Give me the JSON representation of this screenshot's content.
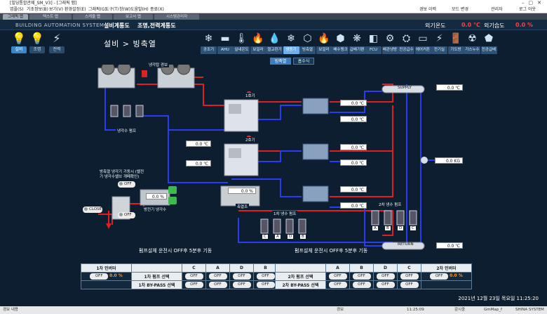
{
  "window": {
    "title": "[빌딩통합관제_SM_V3] - [그래픽 맵]"
  },
  "menu": {
    "items": [
      "엽플(S)",
      "기초정보(B)",
      "보기(V)",
      "환경설정(E)",
      "그래픽(G)",
      "도구(T)",
      "창(W)",
      "도움말(H)",
      "종료(X)"
    ],
    "right": [
      "경보 이력",
      "모드 변경",
      "관리자",
      "로그 아웃"
    ]
  },
  "tabs": [
    "그래픽 맵",
    "텍스트 맵",
    "스케쥴 맵",
    "보고서 맵",
    "시스템관리자"
  ],
  "header": {
    "system_name": "BUILDING AUTOMATION SYSTEM",
    "nav1": "설비계통도",
    "nav2": "조명,전력계통도",
    "out_temp_label": "외기온도",
    "out_temp_value": "0.0 ℃",
    "out_hum_label": "외기습도",
    "out_hum_value": "0.0 %"
  },
  "modes": [
    "설비",
    "조명",
    "전력"
  ],
  "page_title": "설비 > 빙축열",
  "icon_menu": [
    "공조기",
    "AHU",
    "실내온도",
    "보일러",
    "열교환기",
    "냉동기",
    "빙축열",
    "보일러",
    "배수탱크",
    "급배기팬",
    "FCU",
    "배관냉방",
    "진공급수",
    "에어커튼",
    "전기실",
    "기도방",
    "가스누수",
    "진공급배"
  ],
  "subtabs": [
    "빙축열",
    "흡수식"
  ],
  "diagram": {
    "tower_label": "냉각탑 경보",
    "chiller1": "1호기",
    "chiller2": "2호기",
    "cooling_pump": "냉각수 펌프",
    "temps": [
      "0.0 ℃",
      "0.0 ℃",
      "0.0 ℃",
      "0.0 ℃",
      "0.0 ℃",
      "0.0 ℃",
      "0.0 ℃",
      "0.0 ℃",
      "0.0 ℃",
      "0.0 ℃",
      "0.0 ℃",
      "0.0 ℃",
      "0.0 ℃",
      "0.0 ℃",
      "0.0 ℃",
      "0.0 ℃"
    ],
    "flow": "0.0 KG",
    "tank_pct": "0.0 %",
    "tank_label": "축열조",
    "hl_pct": "0.0 %",
    "hl_label": "방전기 냉각수",
    "valve_note": "방축열 냉각기 가동시 (밸전기 냉각수밸브 개폐확인)",
    "off": "OFF",
    "close": "CLOSE",
    "supply": "SUPPLY",
    "return": "RETURN",
    "pump1": "1차 냉수 펌프",
    "pump2": "2차 냉수 펌프",
    "pump1_tags": [
      "C",
      "A",
      "D",
      "B"
    ],
    "pump2_tags": [
      "A",
      "B",
      "D",
      "C"
    ],
    "note1": "펌프설체 운전시 OFF후 5분후 기동",
    "note2": "펌프설체 운전시 OFF후 5분후 기동"
  },
  "table_left": {
    "inverter": "1차 인버터",
    "pct": "0.0 %",
    "cols": [
      "C",
      "A",
      "D",
      "B"
    ],
    "row1": "1차 펌프 선택",
    "row2": "1차 BY-PASS 선택",
    "off": "OFF"
  },
  "table_right": {
    "inverter": "2차 인버터",
    "pct": "0.0 %",
    "cols": [
      "A",
      "B",
      "D",
      "C"
    ],
    "row1": "2차 펌프 선택",
    "row2": "2차 BY-PASS 선택",
    "off": "OFF"
  },
  "datetime": "2021년 12월 23일 목요일 11:25:20",
  "status": {
    "left": "경보 내용",
    "items": [
      "경보",
      "11:25:09",
      "감시중",
      "GmMap_f",
      "SHINA SYSTEM"
    ]
  }
}
